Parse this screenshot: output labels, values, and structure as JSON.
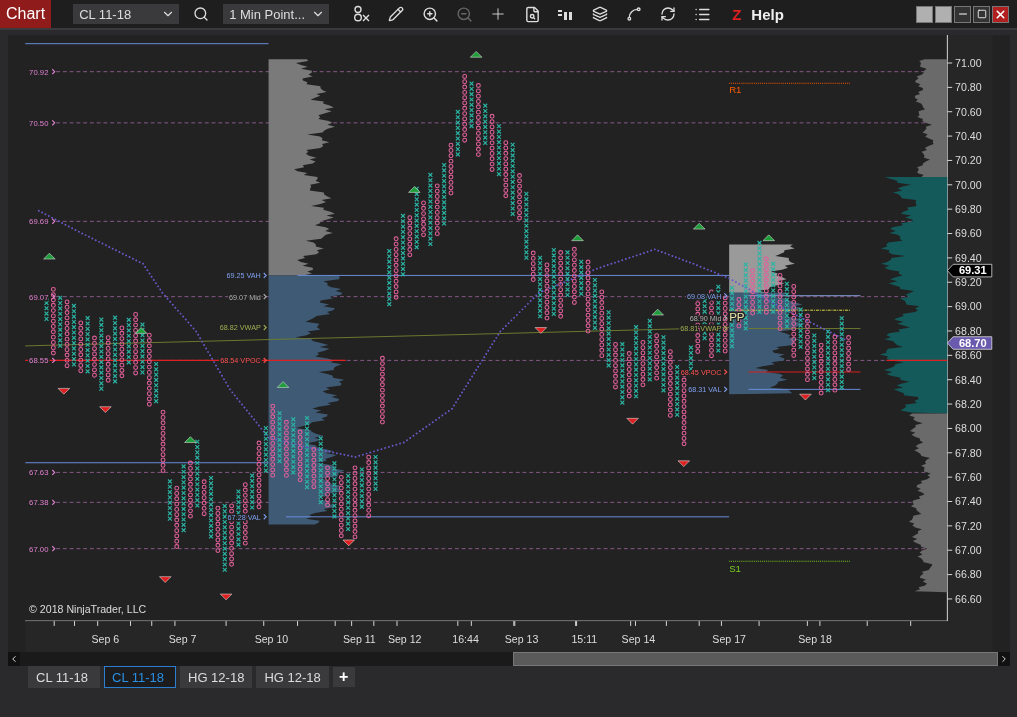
{
  "toolbar": {
    "title": "Chart",
    "instrument": "CL 11-18",
    "interval": "1 Min Point...",
    "z_badge": "Z",
    "help": "Help"
  },
  "chart": {
    "grid_labels": [
      "70.92",
      "70.50",
      "69.69",
      "69.07",
      "68.55",
      "67.63",
      "67.38",
      "67.00"
    ],
    "profile_labels": [
      {
        "text": "69.25 VAH",
        "kind": "vah"
      },
      {
        "text": "69.07 Mid",
        "kind": "mid"
      },
      {
        "text": "68.82 VWAP",
        "kind": "vwap"
      },
      {
        "text": "68.54 VPOC",
        "kind": "vpoc"
      },
      {
        "text": "67.28 VAL",
        "kind": "val"
      },
      {
        "text": "69.08 VAH",
        "kind": "vah"
      },
      {
        "text": "68.90 Mid",
        "kind": "mid"
      },
      {
        "text": "68.81 VWAP",
        "kind": "vwap"
      },
      {
        "text": "68.45 VPOC",
        "kind": "vpoc"
      },
      {
        "text": "68.31 VAL",
        "kind": "val"
      }
    ],
    "pivots": [
      {
        "text": "R1",
        "kind": "resistance"
      },
      {
        "text": "PP",
        "kind": "pivot"
      },
      {
        "text": "S1",
        "kind": "support"
      }
    ],
    "price_axis": [
      "71.00",
      "70.80",
      "70.60",
      "70.40",
      "70.20",
      "70.00",
      "69.80",
      "69.60",
      "69.40",
      "69.20",
      "69.00",
      "68.80",
      "68.60",
      "68.40",
      "68.20",
      "68.00",
      "67.80",
      "67.60",
      "67.40",
      "67.20",
      "67.00",
      "66.80",
      "66.60"
    ],
    "price_markers": [
      {
        "text": "69.31",
        "kind": "last"
      },
      {
        "text": "68.70",
        "kind": "vwap"
      }
    ],
    "time_axis": [
      "Sep 6",
      "Sep 7",
      "Sep 10",
      "Sep 11",
      "Sep 12",
      "16:44",
      "Sep 13",
      "15:11",
      "Sep 14",
      "Sep 17",
      "Sep 18"
    ],
    "copyright": "© 2018 NinjaTrader, LLC"
  },
  "tabs": [
    {
      "label": "CL 11-18",
      "selected": false
    },
    {
      "label": "CL 11-18",
      "selected": true
    },
    {
      "label": "HG 12-18",
      "selected": false
    },
    {
      "label": "HG 12-18",
      "selected": false
    }
  ],
  "add_tab": "+"
}
